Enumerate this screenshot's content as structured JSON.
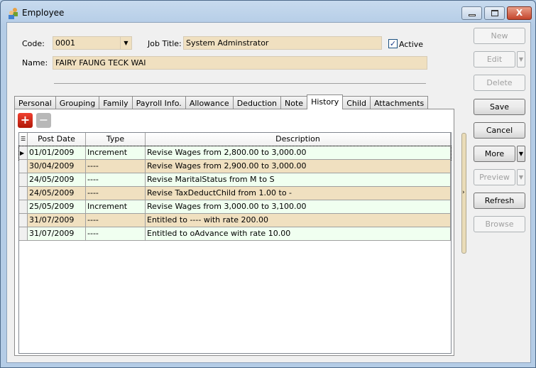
{
  "window": {
    "title": "Employee"
  },
  "form": {
    "code_label": "Code:",
    "code_value": "0001",
    "job_title_label": "Job Title:",
    "job_title_value": "System Adminstrator",
    "active_label": "Active",
    "active_checked": true,
    "name_label": "Name:",
    "name_value": "FAIRY FAUNG TECK WAI"
  },
  "tabs": [
    "Personal",
    "Grouping",
    "Family",
    "Payroll Info.",
    "Allowance",
    "Deduction",
    "Note",
    "History",
    "Child",
    "Attachments"
  ],
  "active_tab": "History",
  "grid": {
    "columns": [
      "Post Date",
      "Type",
      "Description"
    ],
    "rows": [
      [
        "01/01/2009",
        "Increment",
        "Revise Wages from 2,800.00 to 3,000.00"
      ],
      [
        "30/04/2009",
        "----",
        "Revise Wages from 2,900.00 to 3,000.00"
      ],
      [
        "24/05/2009",
        "----",
        "Revise MaritalStatus from M to S"
      ],
      [
        "24/05/2009",
        "----",
        "Revise TaxDeductChild from 1.00 to -"
      ],
      [
        "25/05/2009",
        "Increment",
        "Revise Wages from 3,000.00 to 3,100.00"
      ],
      [
        "31/07/2009",
        "----",
        "Entitled to ---- with rate 200.00"
      ],
      [
        "31/07/2009",
        "----",
        "Entitled to oAdvance with rate 10.00"
      ]
    ]
  },
  "colors": {
    "row_even": "#f0fff0",
    "row_odd": "#f0e0c0",
    "field": "#f0e0c0"
  },
  "buttons": {
    "new": "New",
    "edit": "Edit",
    "delete": "Delete",
    "save": "Save",
    "cancel": "Cancel",
    "more": "More",
    "preview": "Preview",
    "refresh": "Refresh",
    "browse": "Browse"
  }
}
